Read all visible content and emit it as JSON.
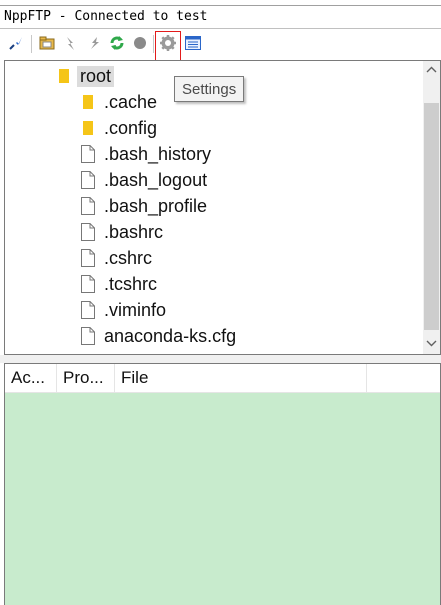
{
  "window": {
    "title": "NppFTP - Connected to test"
  },
  "toolbar": {
    "buttons": [
      {
        "icon": "connect-icon"
      },
      {
        "icon": "open-directory-icon"
      },
      {
        "icon": "download-icon"
      },
      {
        "icon": "upload-icon"
      },
      {
        "icon": "refresh-icon"
      },
      {
        "icon": "abort-icon"
      },
      {
        "icon": "settings-icon"
      },
      {
        "icon": "message-window-icon"
      }
    ],
    "tooltip": "Settings"
  },
  "tree": {
    "root": "root",
    "folders": [
      ".cache",
      ".config"
    ],
    "files": [
      ".bash_history",
      ".bash_logout",
      ".bash_profile",
      ".bashrc",
      ".cshrc",
      ".tcshrc",
      ".viminfo",
      "anaconda-ks.cfg"
    ]
  },
  "queue": {
    "columns": [
      "Ac...",
      "Pro...",
      "File"
    ]
  },
  "colors": {
    "queue_background": "#c8ebcd",
    "folder": "#f5c518",
    "highlight": "#e21b1b"
  }
}
